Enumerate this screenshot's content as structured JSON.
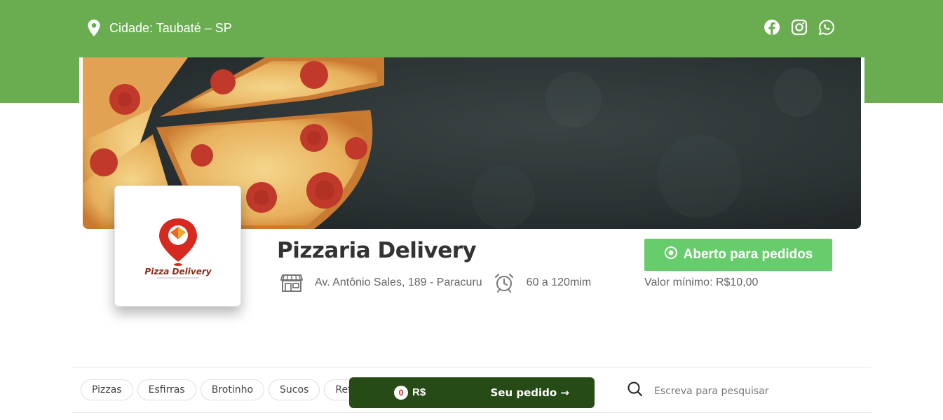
{
  "header": {
    "city_label": "Cidade: Taubaté – SP",
    "location_icon": "map-pin-icon",
    "socials": [
      {
        "name": "facebook",
        "icon": "facebook-icon"
      },
      {
        "name": "instagram",
        "icon": "instagram-icon"
      },
      {
        "name": "whatsapp",
        "icon": "whatsapp-icon"
      }
    ],
    "band_color": "#6aad51"
  },
  "banner": {
    "image": "pepperoni-pizza-on-dark-slate"
  },
  "store": {
    "logo_text": "Pizza Delivery",
    "name": "Pizzaria Delivery",
    "address": "Av. Antônio Sales, 189 - Paracuru",
    "delivery_time": "60 a 120mim",
    "status_button": "Aberto para pedidos",
    "min_order": "Valor mínimo: R$10,00",
    "status_color": "#67cd6c"
  },
  "categories": [
    "Pizzas",
    "Esfirras",
    "Brotinho",
    "Sucos",
    "Refrigerantes"
  ],
  "cart": {
    "count": "0",
    "total": "R$",
    "order_label": "Seu pedido →",
    "color": "#264b17"
  },
  "search": {
    "placeholder": "Escreva para pesquisar"
  }
}
